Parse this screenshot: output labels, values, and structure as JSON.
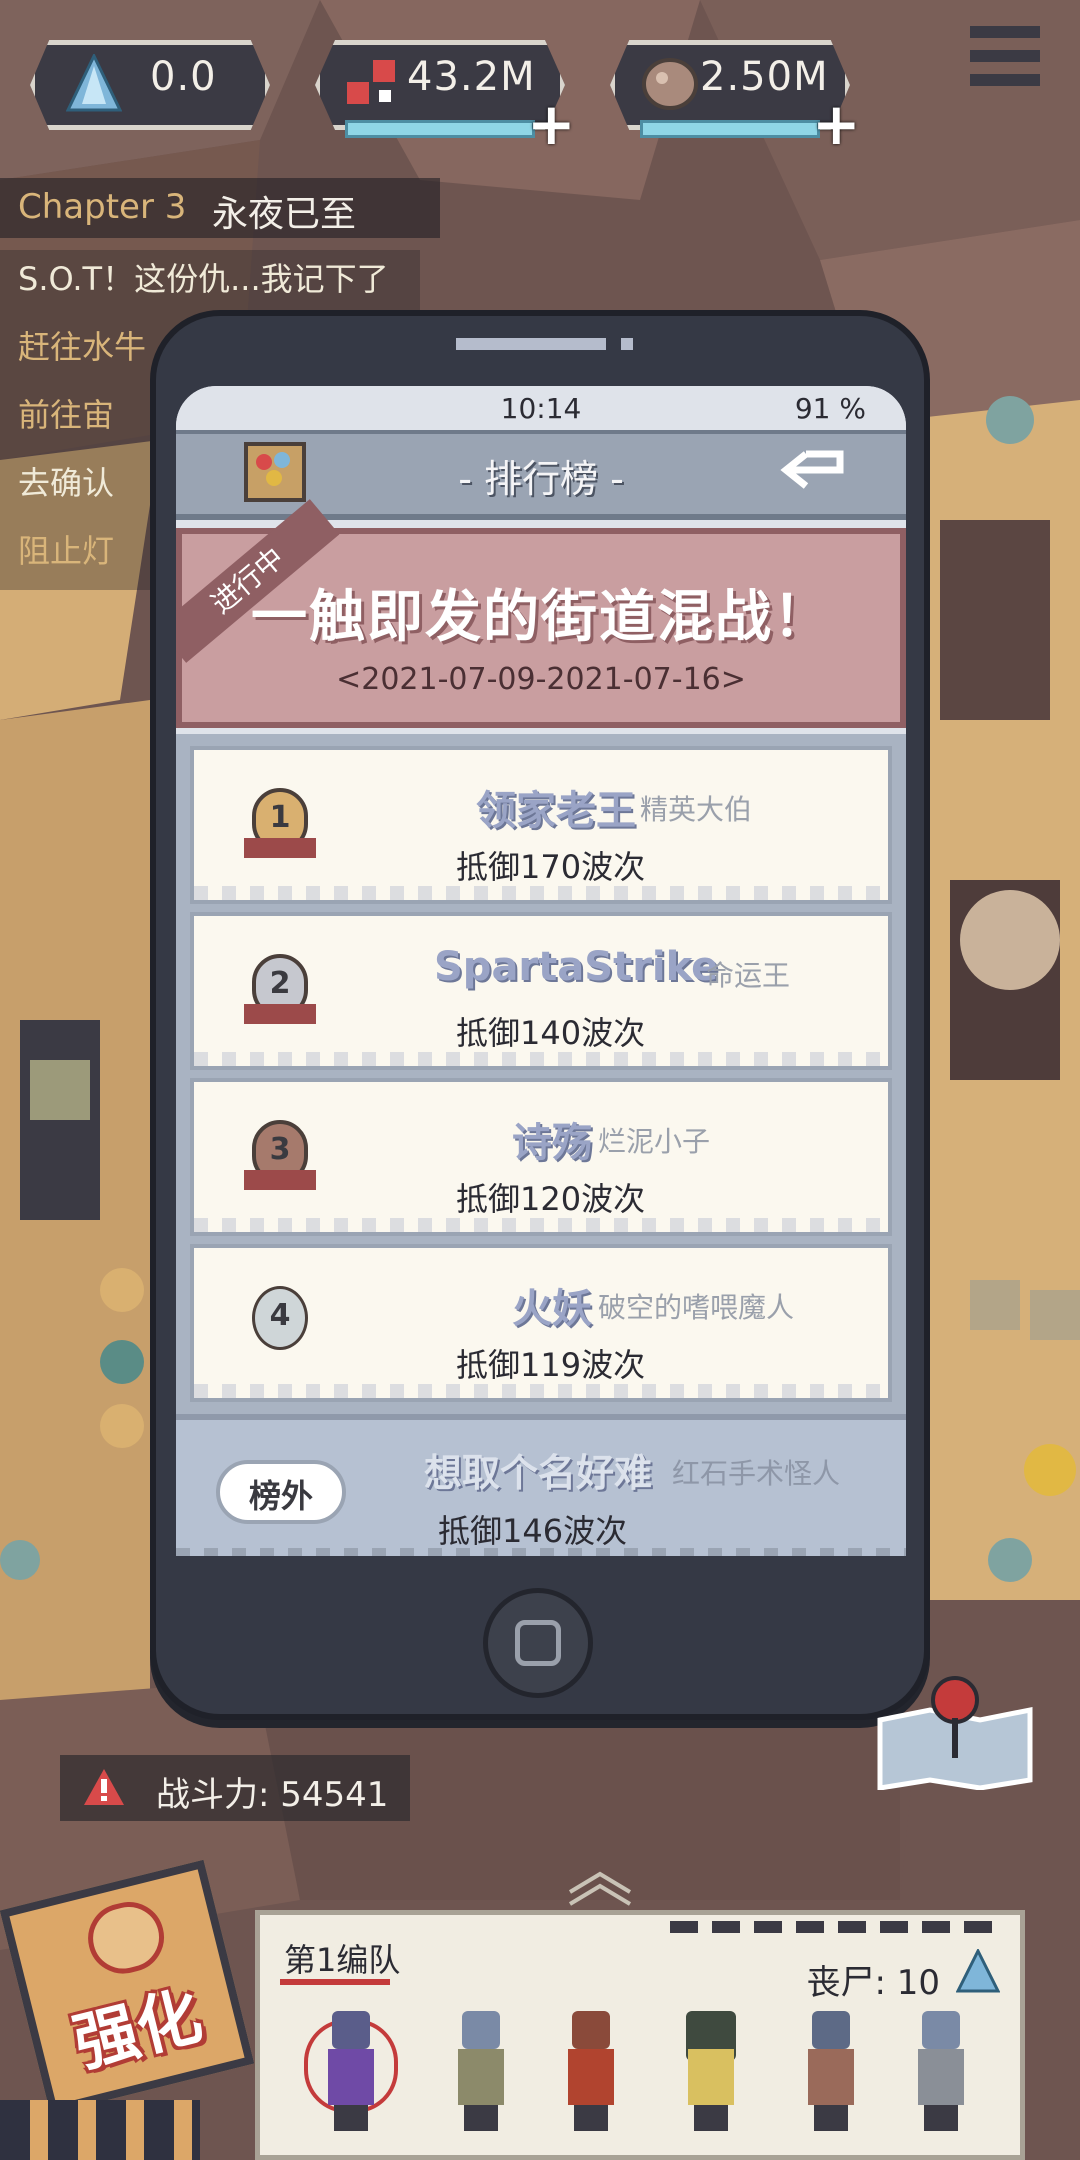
{
  "resources": [
    {
      "icon": "crystal-icon",
      "value": "0.0",
      "has_plus": false
    },
    {
      "icon": "material-icon",
      "value": "43.2M",
      "has_plus": true
    },
    {
      "icon": "ore-icon",
      "value": "2.50M",
      "has_plus": true
    }
  ],
  "quest_panel": {
    "chapter_num": "Chapter 3",
    "chapter_name": "永夜已至",
    "quests": [
      {
        "text": "S.O.T！这份仇...我记下了",
        "color": "white"
      },
      {
        "text": "赶往水牛",
        "color": "gold"
      },
      {
        "text": "前往宙",
        "color": "gold"
      },
      {
        "text": "去确认",
        "color": "white"
      },
      {
        "text": "阻止灯",
        "color": "gold"
      }
    ]
  },
  "phone": {
    "time": "10:14",
    "battery": "91 %",
    "title": "- 排行榜 -",
    "event": {
      "badge": "进行中",
      "name": "一触即发的街道混战！",
      "dates": "<2021-07-09-2021-07-16>"
    },
    "ranks": [
      {
        "rank": "1",
        "name": "领家老王",
        "title": "精英大伯",
        "score": "抵御170波次"
      },
      {
        "rank": "2",
        "name": "SpartaStrike",
        "title": "命运王",
        "score": "抵御140波次"
      },
      {
        "rank": "3",
        "name": "诗殇",
        "title": "烂泥小子",
        "score": "抵御120波次"
      },
      {
        "rank": "4",
        "name": "火妖",
        "title": "破空的嗜喂魔人",
        "score": "抵御119波次"
      }
    ],
    "me": {
      "tag": "榜外",
      "name": "想取个名好难",
      "title": "红石手术怪人",
      "score": "抵御146波次"
    }
  },
  "hud": {
    "power_label": "战斗力:",
    "power_value": "54541",
    "team_name": "第1编队",
    "zombie_label": "丧尸:",
    "zombie_count": "10",
    "upgrade_label": "强化"
  },
  "colors": {
    "medal_gold": "#d9b070",
    "medal_silver": "#c6c8cf",
    "medal_bronze": "#a67a6c",
    "medal_plain": "#cfd6d8",
    "event_bg": "#c99ea0",
    "accent_red": "#c43b3b"
  }
}
